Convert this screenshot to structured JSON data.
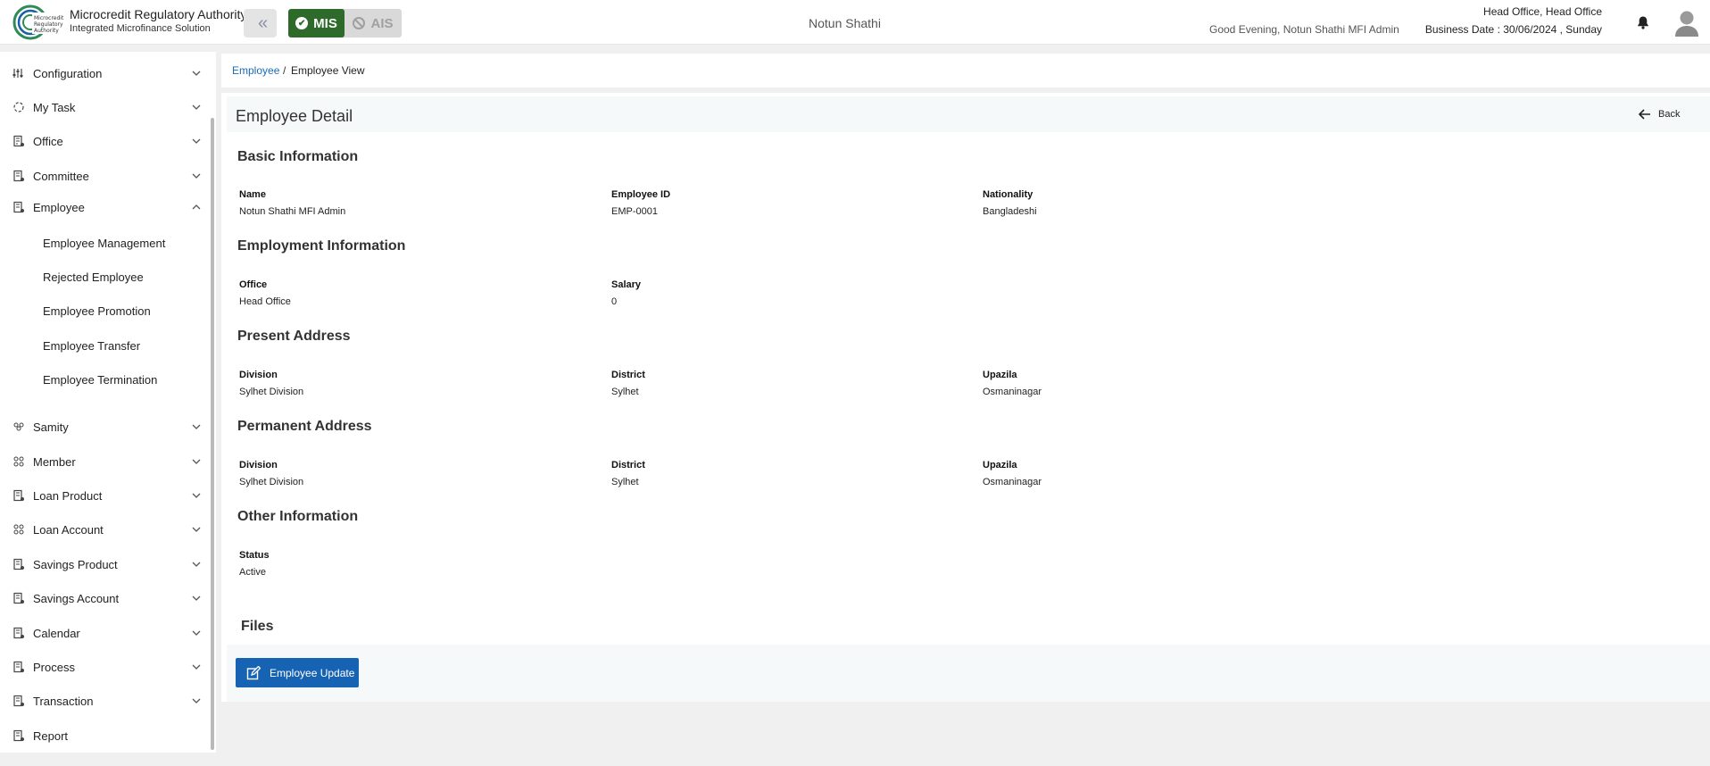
{
  "header": {
    "brand_title": "Microcredit Regulatory Authority",
    "brand_subtitle": "Integrated Microfinance Solution",
    "logo_text": "Microcredit Regulatory Authority",
    "mode_mis": "MIS",
    "mode_ais": "AIS",
    "org_name": "Notun Shathi",
    "greeting": "Good Evening, Notun Shathi MFI Admin",
    "office": "Head Office, Head Office",
    "business_date": "Business Date : 30/06/2024 , Sunday",
    "accent_color": "#2e6b2a"
  },
  "sidebar": {
    "items": [
      {
        "label": "Configuration",
        "icon": "sliders-icon"
      },
      {
        "label": "My Task",
        "icon": "task-icon"
      },
      {
        "label": "Office",
        "icon": "building-icon"
      },
      {
        "label": "Committee",
        "icon": "committee-icon"
      },
      {
        "label": "Employee",
        "icon": "employee-icon",
        "expanded": true
      },
      {
        "label": "Samity",
        "icon": "group-icon"
      },
      {
        "label": "Member",
        "icon": "member-icon"
      },
      {
        "label": "Loan Product",
        "icon": "loan-product-icon"
      },
      {
        "label": "Loan Account",
        "icon": "loan-account-icon"
      },
      {
        "label": "Savings Product",
        "icon": "savings-product-icon"
      },
      {
        "label": "Savings Account",
        "icon": "savings-account-icon"
      },
      {
        "label": "Calendar",
        "icon": "calendar-icon"
      },
      {
        "label": "Process",
        "icon": "process-icon"
      },
      {
        "label": "Transaction",
        "icon": "transaction-icon"
      },
      {
        "label": "Report",
        "icon": "report-icon"
      }
    ],
    "employee_sub": [
      "Employee Management",
      "Rejected Employee",
      "Employee Promotion",
      "Employee Transfer",
      "Employee Termination"
    ]
  },
  "breadcrumb": {
    "parent": "Employee",
    "separator": "/",
    "current": "Employee View"
  },
  "panel": {
    "title": "Employee Detail",
    "back_label": "Back"
  },
  "sections": {
    "basic": {
      "title": "Basic Information",
      "name_label": "Name",
      "name_value": "Notun Shathi MFI Admin",
      "id_label": "Employee ID",
      "id_value": "EMP-0001",
      "nationality_label": "Nationality",
      "nationality_value": "Bangladeshi"
    },
    "employment": {
      "title": "Employment Information",
      "office_label": "Office",
      "office_value": "Head Office",
      "salary_label": "Salary",
      "salary_value": "0"
    },
    "present": {
      "title": "Present Address",
      "division_label": "Division",
      "division_value": "Sylhet Division",
      "district_label": "District",
      "district_value": "Sylhet",
      "upazila_label": "Upazila",
      "upazila_value": "Osmaninagar"
    },
    "permanent": {
      "title": "Permanent Address",
      "division_label": "Division",
      "division_value": "Sylhet Division",
      "district_label": "District",
      "district_value": "Sylhet",
      "upazila_label": "Upazila",
      "upazila_value": "Osmaninagar"
    },
    "other": {
      "title": "Other Information",
      "status_label": "Status",
      "status_value": "Active"
    }
  },
  "files": {
    "title": "Files",
    "update_button": "Employee Update"
  }
}
